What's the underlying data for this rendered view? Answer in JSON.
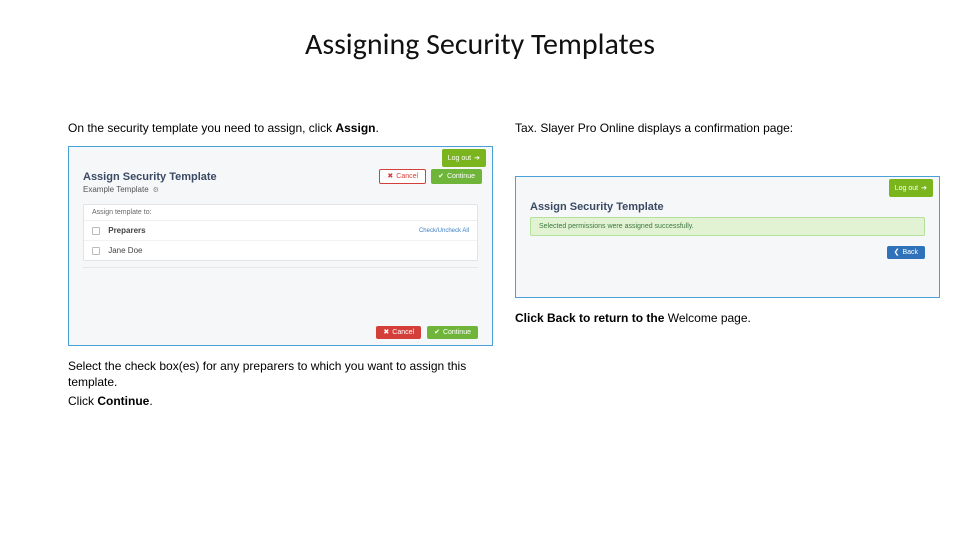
{
  "title": "Assigning Security Templates",
  "left": {
    "instr_prefix": "On the security template you need to assign, click ",
    "instr_bold": "Assign",
    "instr_suffix": ".",
    "panel": {
      "logout": "Log out",
      "heading": "Assign Security Template",
      "subheading": "Example Template",
      "cancel": "Cancel",
      "continue": "Continue",
      "card_header": "Assign template to:",
      "row1_label": "Preparers",
      "row1_toggle": "Check/Uncheck All",
      "row2_label": "Jane Doe"
    },
    "note1": "Select the check box(es) for any preparers to which you want to assign this template.",
    "note2_prefix": "Click ",
    "note2_bold": "Continue",
    "note2_suffix": "."
  },
  "right": {
    "instr": "Tax. Slayer Pro Online displays a confirmation page:",
    "panel": {
      "logout": "Log out",
      "heading": "Assign Security Template",
      "success": "Selected permissions were assigned successfully.",
      "back": "Back"
    },
    "note_prefix": "Click Back to return to the ",
    "note_plain": "Welcome page."
  }
}
